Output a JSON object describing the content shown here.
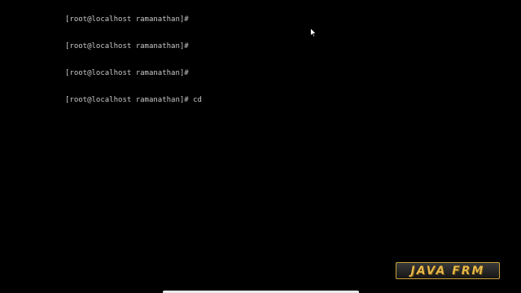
{
  "terminal": {
    "lines": [
      "[root@localhost ramanathan]#",
      "[root@localhost ramanathan]#",
      "[root@localhost ramanathan]#",
      "[root@localhost ramanathan]# cd"
    ]
  },
  "watermark": {
    "text": "JAVA FRM"
  },
  "colors": {
    "background": "#000000",
    "terminal_text": "#c8c8c8",
    "watermark_gold": "#e7b84a"
  },
  "icons": {
    "cursor": "mouse-pointer-icon"
  }
}
